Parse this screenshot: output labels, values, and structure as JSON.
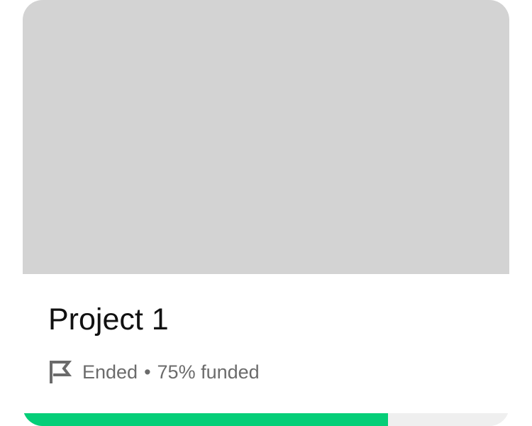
{
  "project": {
    "title": "Project 1",
    "status": "Ended",
    "separator": "•",
    "funded_text": "75% funded",
    "funded_fraction": 0.75,
    "icon": "flag-icon"
  },
  "colors": {
    "thumbnail": "#d3d3d3",
    "progress_fill": "#05ce78",
    "progress_track": "#efefef",
    "meta_text": "#6b6b6b",
    "title_text": "#111111"
  }
}
